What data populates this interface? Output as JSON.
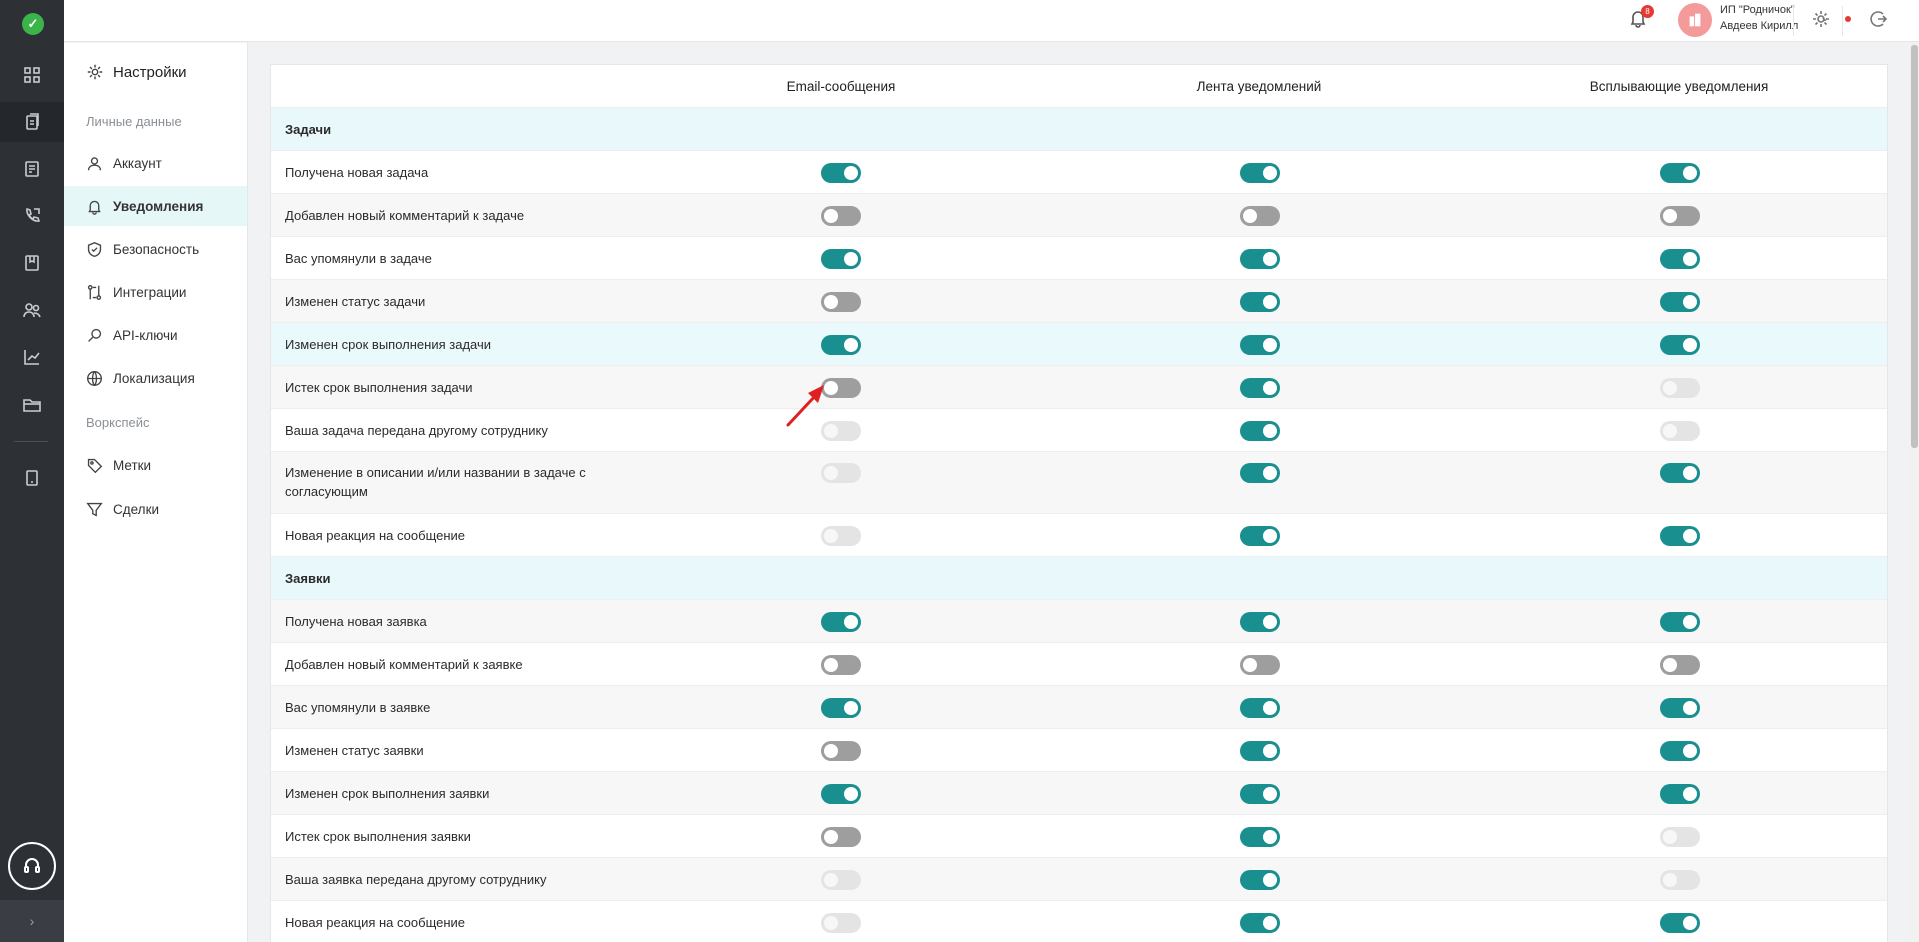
{
  "header": {
    "notifications_count": "8",
    "company": "ИП \"Родничок\"",
    "user": "Авдеев Кирилл"
  },
  "sidebar": {
    "title": "Настройки",
    "section_personal": "Личные данные",
    "section_workspace": "Воркспейс",
    "items": [
      {
        "label": "Аккаунт",
        "icon": "user-icon"
      },
      {
        "label": "Уведомления",
        "icon": "bell-icon"
      },
      {
        "label": "Безопасность",
        "icon": "shield-icon"
      },
      {
        "label": "Интеграции",
        "icon": "integrations-icon"
      },
      {
        "label": "API-ключи",
        "icon": "key-icon"
      },
      {
        "label": "Локализация",
        "icon": "globe-icon"
      },
      {
        "label": "Метки",
        "icon": "tag-icon"
      },
      {
        "label": "Сделки",
        "icon": "funnel-icon"
      }
    ]
  },
  "table": {
    "columns": [
      "Email-сообщения",
      "Лента уведомлений",
      "Всплывающие уведомления"
    ],
    "sections": [
      {
        "title": "Задачи",
        "rows": [
          {
            "label": "Получена новая задача",
            "email": "on",
            "feed": "on",
            "popup": "on"
          },
          {
            "label": "Добавлен новый комментарий к задаче",
            "email": "off",
            "feed": "off",
            "popup": "off"
          },
          {
            "label": "Вас упомянули в задаче",
            "email": "on",
            "feed": "on",
            "popup": "on"
          },
          {
            "label": "Изменен статус задачи",
            "email": "off",
            "feed": "on",
            "popup": "on"
          },
          {
            "label": "Изменен срок выполнения задачи",
            "email": "on",
            "feed": "on",
            "popup": "on"
          },
          {
            "label": "Истек срок выполнения задачи",
            "email": "off",
            "feed": "on",
            "popup": "disabled"
          },
          {
            "label": "Ваша задача передана другому сотруднику",
            "email": "disabled",
            "feed": "on",
            "popup": "disabled"
          },
          {
            "label": "Изменение в описании и/или названии в задаче с согласующим",
            "email": "disabled",
            "feed": "on",
            "popup": "on"
          },
          {
            "label": "Новая реакция на сообщение",
            "email": "disabled",
            "feed": "on",
            "popup": "on"
          }
        ]
      },
      {
        "title": "Заявки",
        "rows": [
          {
            "label": "Получена новая заявка",
            "email": "on",
            "feed": "on",
            "popup": "on"
          },
          {
            "label": "Добавлен новый комментарий к заявке",
            "email": "off",
            "feed": "off",
            "popup": "off"
          },
          {
            "label": "Вас упомянули в заявке",
            "email": "on",
            "feed": "on",
            "popup": "on"
          },
          {
            "label": "Изменен статус заявки",
            "email": "off",
            "feed": "on",
            "popup": "on"
          },
          {
            "label": "Изменен срок выполнения заявки",
            "email": "on",
            "feed": "on",
            "popup": "on"
          },
          {
            "label": "Истек срок выполнения заявки",
            "email": "off",
            "feed": "on",
            "popup": "disabled"
          },
          {
            "label": "Ваша заявка передана другому сотруднику",
            "email": "disabled",
            "feed": "on",
            "popup": "disabled"
          },
          {
            "label": "Новая реакция на сообщение",
            "email": "disabled",
            "feed": "on",
            "popup": "on"
          }
        ]
      }
    ]
  },
  "colors": {
    "accent": "#1a8f8f",
    "toggle_off": "#9e9e9e",
    "toggle_disabled": "#e4e4e4",
    "section_bg": "#e9f9fb",
    "rail_bg": "#2d3035",
    "annotation_arrow": "#e02020"
  }
}
